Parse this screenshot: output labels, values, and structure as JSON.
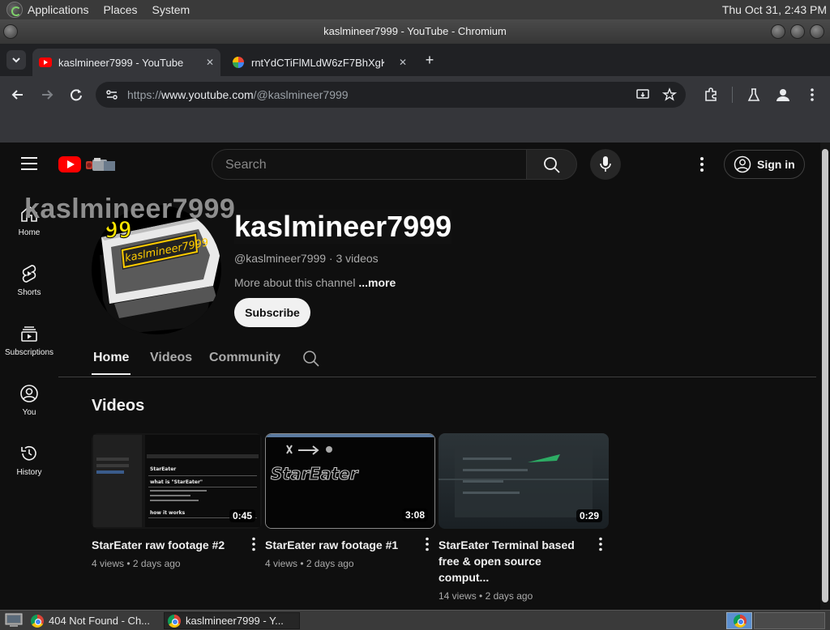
{
  "desktop": {
    "menus": [
      "Applications",
      "Places",
      "System"
    ],
    "clock": "Thu Oct 31,  2:43 PM"
  },
  "window": {
    "title": "kaslmineer7999 - YouTube - Chromium"
  },
  "tabs": [
    {
      "label": "kaslmineer7999 - YouTube",
      "close": "✕"
    },
    {
      "label": "rntYdCTiFlMLdW6zF7BhXgK",
      "close": "✕"
    }
  ],
  "new_tab": "+",
  "omnibox": {
    "scheme": "https://",
    "host": "www.youtube.com",
    "path": "/@kaslmineer7999"
  },
  "youtube": {
    "search_placeholder": "Search",
    "sign_in": "Sign in",
    "guide": [
      {
        "label": "Home",
        "icon": "home-icon"
      },
      {
        "label": "Shorts",
        "icon": "shorts-icon"
      },
      {
        "label": "Subscriptions",
        "icon": "subscriptions-icon"
      },
      {
        "label": "You",
        "icon": "you-icon"
      },
      {
        "label": "History",
        "icon": "history-icon"
      }
    ],
    "channel": {
      "banner_text": "kaslmineer7999",
      "name": "kaslmineer7999",
      "handle": "@kaslmineer7999",
      "separator": " · ",
      "video_count": "3 videos",
      "about": "More about this channel",
      "more": "...more",
      "subscribe": "Subscribe",
      "avatar_badge": "99",
      "avatar_text": "kaslmineer7999"
    },
    "channel_tabs": [
      "Home",
      "Videos",
      "Community"
    ],
    "section_title": "Videos",
    "videos": [
      {
        "title": "StarEater raw footage #2",
        "views": "4 views",
        "age": "2 days ago",
        "duration": "0:45"
      },
      {
        "title": "StarEater raw footage #1",
        "views": "4 views",
        "age": "2 days ago",
        "duration": "3:08"
      },
      {
        "title": "StarEater Terminal based free & open source comput...",
        "views": "14 views",
        "age": "2 days ago",
        "duration": "0:29"
      }
    ],
    "meta_separator": " • ",
    "thumb1_lines": [
      "StarEater",
      "what is \"StarEater\"",
      "how it works"
    ],
    "thumb2_text": "StarEater"
  },
  "taskbar": [
    {
      "label": "404 Not Found - Ch..."
    },
    {
      "label": "kaslmineer7999 - Y..."
    }
  ]
}
